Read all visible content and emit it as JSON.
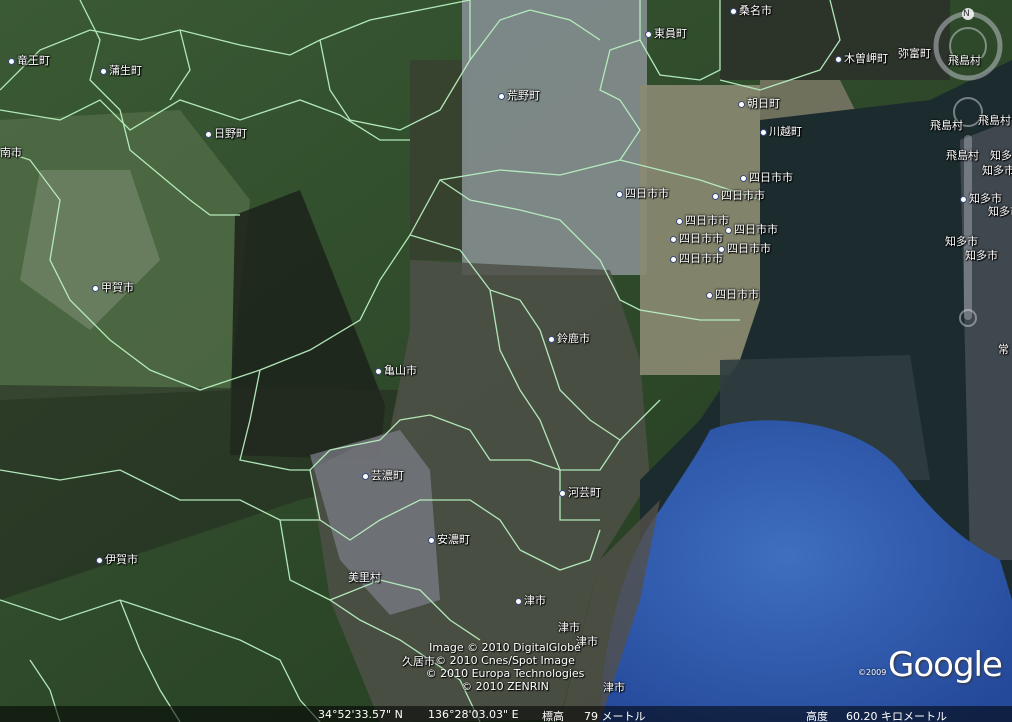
{
  "labels": [
    {
      "text": "竜王町"
    },
    {
      "text": "蒲生町"
    },
    {
      "text": "日野町"
    },
    {
      "text": "南市"
    },
    {
      "text": "甲賀市"
    },
    {
      "text": "荒野町"
    },
    {
      "text": "東員町"
    },
    {
      "text": "桑名市"
    },
    {
      "text": "木曽岬町"
    },
    {
      "text": "弥富町"
    },
    {
      "text": "飛島村"
    },
    {
      "text": "朝日町"
    },
    {
      "text": "川越町"
    },
    {
      "text": "飛島村"
    },
    {
      "text": "飛島村"
    },
    {
      "text": "飛島村"
    },
    {
      "text": "知多"
    },
    {
      "text": "知多市"
    },
    {
      "text": "四日市市"
    },
    {
      "text": "四日市市"
    },
    {
      "text": "四日市市"
    },
    {
      "text": "四日市市"
    },
    {
      "text": "四日市市"
    },
    {
      "text": "四日市市"
    },
    {
      "text": "四日市市"
    },
    {
      "text": "四日市市"
    },
    {
      "text": "四日市市"
    },
    {
      "text": "知多市"
    },
    {
      "text": "知多市"
    },
    {
      "text": "知多市"
    },
    {
      "text": "知多市"
    },
    {
      "text": "鈴鹿市"
    },
    {
      "text": "亀山市"
    },
    {
      "text": "芸濃町"
    },
    {
      "text": "河芸町"
    },
    {
      "text": "安濃町"
    },
    {
      "text": "伊賀市"
    },
    {
      "text": "美里村"
    },
    {
      "text": "津市"
    },
    {
      "text": "津市"
    },
    {
      "text": "津市"
    },
    {
      "text": "久居市"
    },
    {
      "text": "津市"
    },
    {
      "text": "常"
    }
  ],
  "credits": [
    "Image © 2010 DigitalGlobe",
    "© 2010 Cnes/Spot Image",
    "© 2010 Europa Technologies",
    "© 2010 ZENRIN"
  ],
  "logo": {
    "text": "Google",
    "copyright": "©2009"
  },
  "status": {
    "lat": "34°52'33.57\" N",
    "lon": "136°28'03.03\" E",
    "elev_label": "標高",
    "elev_value": "79 メートル",
    "alt_label": "高度",
    "alt_value": "60.20 キロメートル"
  },
  "compass": {
    "north": "N"
  },
  "colors": {
    "boundary": "#b8f0c0",
    "sea": "#2f5aa6",
    "sea_dark": "#1a2a30",
    "forest": "#2c4a26"
  }
}
